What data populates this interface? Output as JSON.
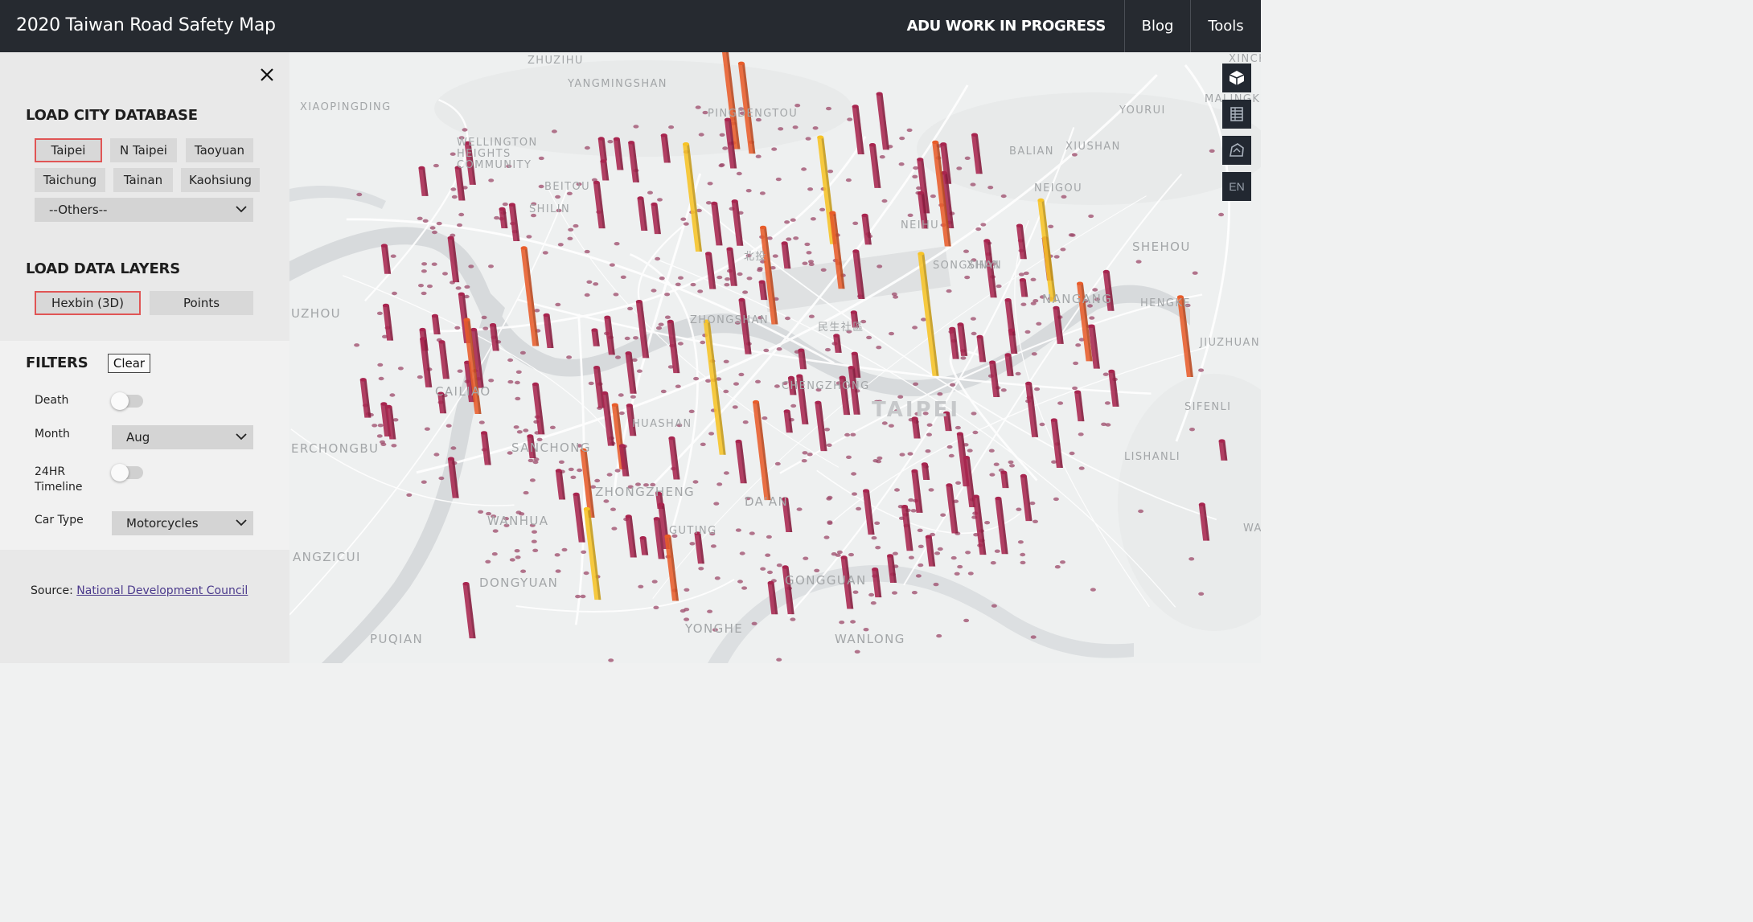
{
  "header": {
    "title": "2020 Taiwan Road Safety Map",
    "brand": "ADU WORK IN PROGRESS",
    "nav": [
      "Blog",
      "Tools"
    ]
  },
  "sidebar": {
    "city_section_title": "LOAD CITY DATABASE",
    "cities": [
      "Taipei",
      "N Taipei",
      "Taoyuan",
      "Taichung",
      "Tainan",
      "Kaohsiung"
    ],
    "active_city": "Taipei",
    "others_select": "--Others--",
    "layers_section_title": "LOAD DATA LAYERS",
    "layers": [
      "Hexbin (3D)",
      "Points"
    ],
    "active_layer": "Hexbin (3D)",
    "filters": {
      "title": "FILTERS",
      "clear_label": "Clear",
      "death_label": "Death",
      "death_on": false,
      "month_label": "Month",
      "month_value": "Aug",
      "timeline_label": "24HR Timeline",
      "timeline_on": false,
      "cartype_label": "Car Type",
      "cartype_value": "Motorcycles"
    },
    "source_prefix": "Source:",
    "source_link": "National Development Council"
  },
  "map": {
    "places": [
      "ZHUZIHU",
      "YANGMINGSHAN",
      "XIAOPINGDING",
      "PINGDENGTOU",
      "YOURUI",
      "MALINGKEN",
      "XINCH",
      "WELLINGTON HEIGHTS COMMUNITY",
      "BALIAN",
      "XIUSHAN",
      "NEIGOU",
      "NEIHU",
      "SHEHOU",
      "UZHOU",
      "NANGANG",
      "HENGKE",
      "JIUZHUAN",
      "CAILIAO",
      "TAIPEI",
      "SIFENLI",
      "ERCHONGBU",
      "SANCHONG",
      "LISHANLI",
      "ZHONGZHENG",
      "DA'AN",
      "WANHUA",
      "GUTING",
      "WA",
      "ANGZICUI",
      "DONGYUAN",
      "GONGGUAN",
      "YONGHE",
      "PUQIAN",
      "WANLONG",
      "HUASHAN",
      "SHILIN",
      "BEITOU",
      "XINYI",
      "ZHONGSHAN",
      "SONGSHAN",
      "CHENGZHONG",
      "北投",
      "民生社區"
    ],
    "controls": [
      "3d-toggle",
      "table",
      "basemap",
      "EN"
    ],
    "colors": {
      "low": "#a8254f",
      "mid": "#e85c2a",
      "high": "#f7c325"
    }
  }
}
